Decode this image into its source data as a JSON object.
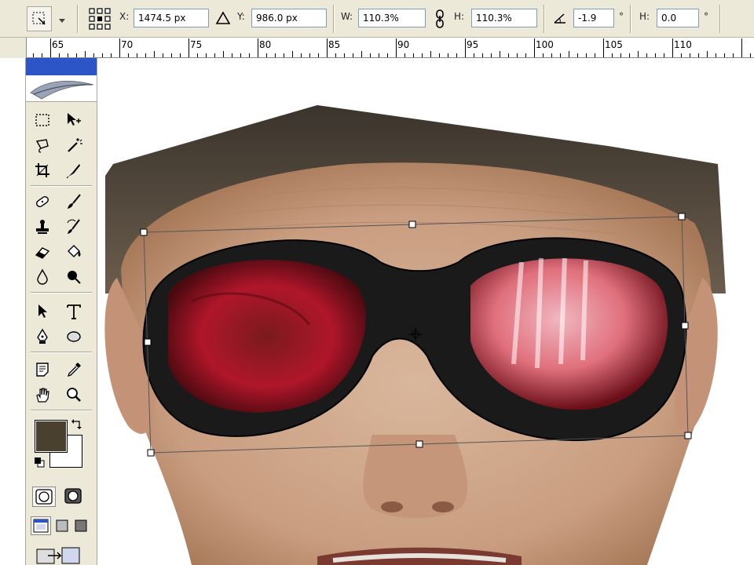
{
  "options_bar": {
    "x_label": "X:",
    "x_value": "1474.5 px",
    "y_label": "Y:",
    "y_value": "986.0 px",
    "w_label": "W:",
    "w_value": "110.3%",
    "h_label": "H:",
    "h_value": "110.3%",
    "rotate_value": "-1.9",
    "rotate_unit": "°",
    "hskew_label": "H:",
    "hskew_value": "0.0",
    "hskew_unit": "°"
  },
  "ruler": {
    "labels": [
      "65",
      "70",
      "75",
      "80",
      "85",
      "90",
      "95",
      "100",
      "105",
      "110"
    ]
  },
  "toolbox": {
    "foreground_color": "#4a4030",
    "background_color": "#ffffff",
    "tools": [
      "rectangular-marquee-icon",
      "move-icon",
      "lasso-icon",
      "magic-wand-icon",
      "crop-icon",
      "slice-icon",
      "healing-brush-icon",
      "brush-icon",
      "clone-stamp-icon",
      "history-brush-icon",
      "eraser-icon",
      "paint-bucket-icon",
      "blur-icon",
      "dodge-icon",
      "path-selection-icon",
      "type-icon",
      "pen-icon",
      "ellipse-shape-icon",
      "notes-icon",
      "eyedropper-icon",
      "hand-icon",
      "zoom-icon"
    ]
  },
  "colors": {
    "ui_face": "#ece9d8",
    "title_blue": "#2c56c8",
    "lens_red": "#c0192a",
    "frame_black": "#1a1a1a"
  }
}
